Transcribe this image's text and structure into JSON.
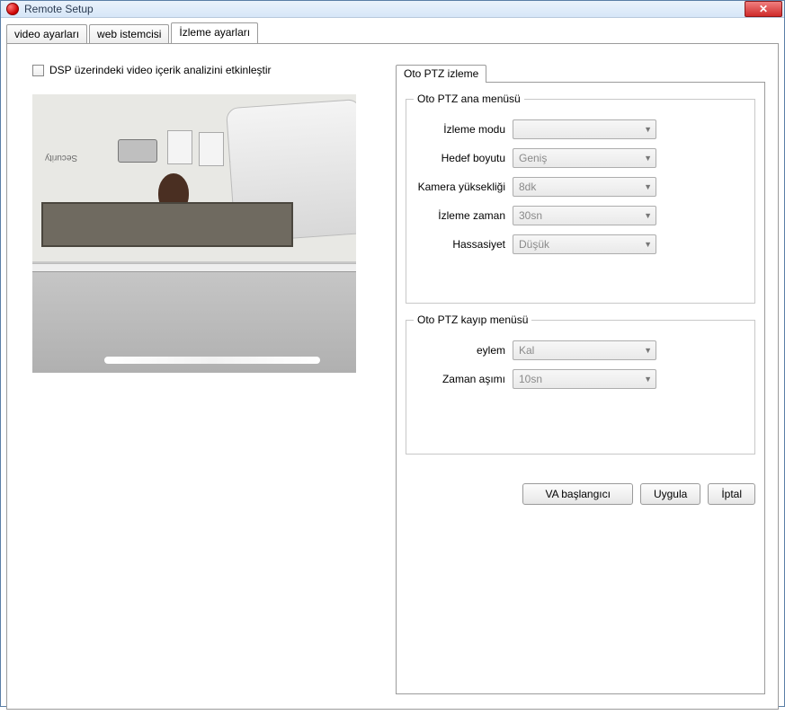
{
  "window": {
    "title": "Remote Setup"
  },
  "tabs": {
    "video": "video ayarları",
    "web": "web istemcisi",
    "tracking": "İzleme ayarları"
  },
  "left": {
    "enable_dsp_label": "DSP üzerindeki video içerik analizini etkinleştir",
    "security_text": "Security"
  },
  "inner_tab": {
    "label": "Oto PTZ izleme"
  },
  "main_menu": {
    "legend": "Oto PTZ ana menüsü",
    "tracking_mode_label": "İzleme modu",
    "tracking_mode_value": "",
    "target_size_label": "Hedef boyutu",
    "target_size_value": "Geniş",
    "camera_height_label": "Kamera yüksekliği",
    "camera_height_value": "8dk",
    "tracking_time_label": "İzleme zaman",
    "tracking_time_value": "30sn",
    "sensitivity_label": "Hassasiyet",
    "sensitivity_value": "Düşük"
  },
  "loss_menu": {
    "legend": "Oto PTZ kayıp menüsü",
    "action_label": "eylem",
    "action_value": "Kal",
    "timeout_label": "Zaman aşımı",
    "timeout_value": "10sn"
  },
  "buttons": {
    "va_start": "VA başlangıcı",
    "apply": "Uygula",
    "cancel": "İptal"
  }
}
